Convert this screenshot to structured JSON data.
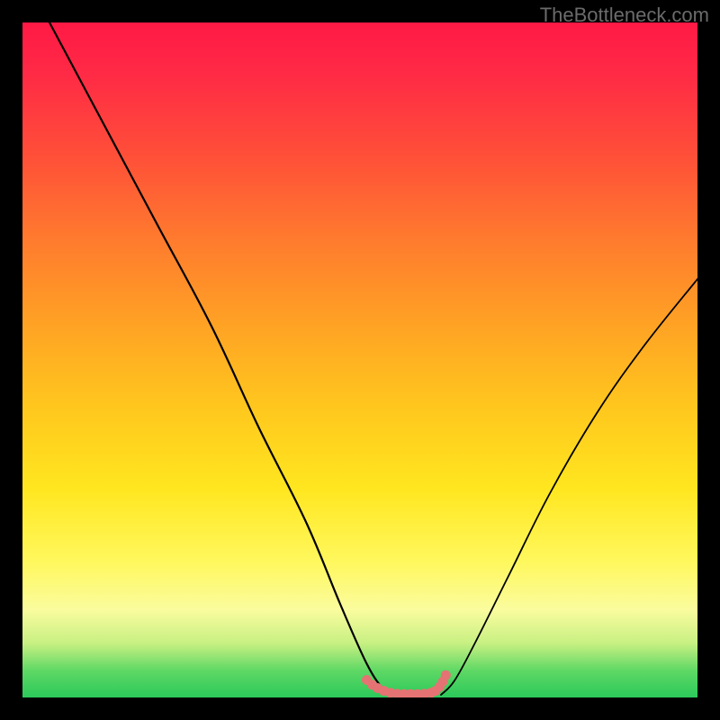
{
  "watermark": "TheBottleneck.com",
  "chart_data": {
    "type": "line",
    "title": "",
    "xlabel": "",
    "ylabel": "",
    "xlim": [
      0,
      100
    ],
    "ylim": [
      0,
      100
    ],
    "grid": false,
    "legend": false,
    "description": "V-shaped bottleneck curve over a rainbow gradient; the minimum (near zero) lies in the green band at the bottom.",
    "series": [
      {
        "name": "left-branch",
        "x": [
          4,
          12,
          20,
          28,
          35,
          42,
          47,
          51,
          53.5,
          55
        ],
        "y": [
          100,
          85,
          70,
          55,
          40,
          26,
          14,
          5,
          1.2,
          0.4
        ]
      },
      {
        "name": "right-branch",
        "x": [
          62,
          64,
          67,
          72,
          78,
          85,
          92,
          100
        ],
        "y": [
          0.4,
          2.5,
          8,
          18,
          30,
          42,
          52,
          62
        ]
      }
    ],
    "markers": {
      "name": "bottleneck-markers",
      "color": "#e57373",
      "points": [
        {
          "x": 51.0,
          "y": 2.6
        },
        {
          "x": 51.8,
          "y": 1.9
        },
        {
          "x": 52.6,
          "y": 1.4
        },
        {
          "x": 53.5,
          "y": 1.0
        },
        {
          "x": 54.5,
          "y": 0.7
        },
        {
          "x": 55.5,
          "y": 0.55
        },
        {
          "x": 56.5,
          "y": 0.5
        },
        {
          "x": 57.5,
          "y": 0.5
        },
        {
          "x": 58.5,
          "y": 0.5
        },
        {
          "x": 59.5,
          "y": 0.55
        },
        {
          "x": 60.5,
          "y": 0.7
        },
        {
          "x": 61.2,
          "y": 1.0
        },
        {
          "x": 61.8,
          "y": 1.6
        },
        {
          "x": 62.3,
          "y": 2.4
        },
        {
          "x": 62.7,
          "y": 3.3
        }
      ]
    }
  }
}
